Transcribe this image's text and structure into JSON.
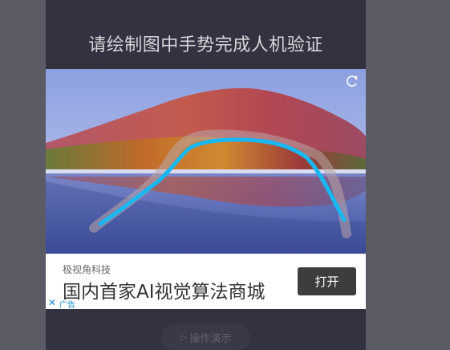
{
  "title": "请绘制图中手势完成人机验证",
  "refresh_icon": "refresh-icon",
  "ad": {
    "company": "极视角科技",
    "headline": "国内首家AI视觉算法商城",
    "button_label": "打开",
    "close_glyph": "✕",
    "tag": "广告"
  },
  "demo_button": {
    "icon": "▷",
    "label": "操作演示"
  },
  "colors": {
    "gesture_stroke": "#19b8f2",
    "background": "#5b5b66",
    "panel": "#333240"
  }
}
